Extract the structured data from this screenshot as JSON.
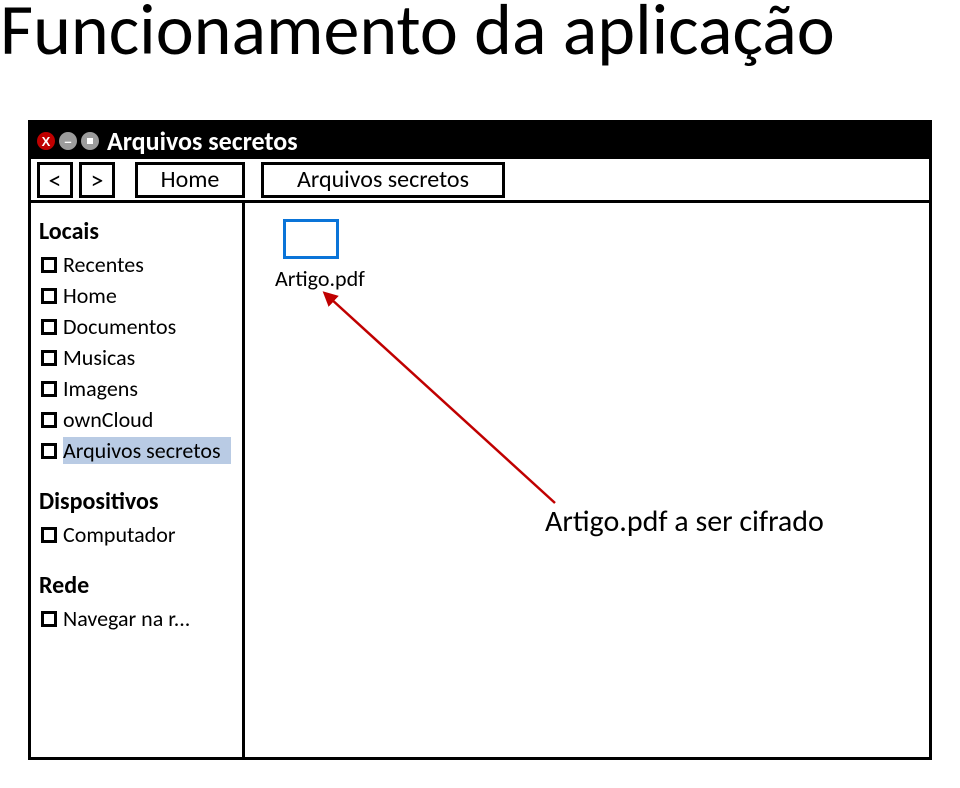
{
  "page_title": "Funcionamento da aplicação",
  "window": {
    "title": "Arquivos secretos",
    "controls": {
      "close_glyph": "X",
      "minimize_glyph": "–"
    },
    "toolbar": {
      "back_glyph": "<",
      "forward_glyph": ">",
      "breadcrumb": {
        "root": "Home",
        "current": "Arquivos secretos"
      }
    }
  },
  "sidebar": {
    "sections": [
      {
        "header": "Locais",
        "items": [
          {
            "label": "Recentes",
            "selected": false
          },
          {
            "label": "Home",
            "selected": false
          },
          {
            "label": "Documentos",
            "selected": false
          },
          {
            "label": "Musicas",
            "selected": false
          },
          {
            "label": "Imagens",
            "selected": false
          },
          {
            "label": "ownCloud",
            "selected": false
          },
          {
            "label": "Arquivos secretos",
            "selected": true
          }
        ]
      },
      {
        "header": "Dispositivos",
        "items": [
          {
            "label": "Computador",
            "selected": false
          }
        ]
      },
      {
        "header": "Rede",
        "items": [
          {
            "label": "Navegar na r...",
            "selected": false
          }
        ]
      }
    ]
  },
  "content": {
    "file": {
      "name": "Artigo.pdf"
    }
  },
  "annotation": "Artigo.pdf a ser cifrado"
}
